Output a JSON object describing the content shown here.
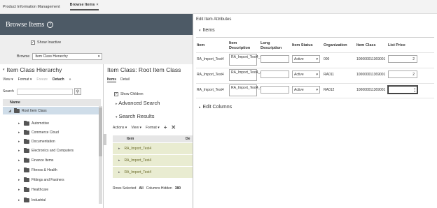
{
  "topbar": {
    "tabs": [
      {
        "label": "Product Information Management"
      },
      {
        "label": "Browse Items",
        "close": "×"
      }
    ]
  },
  "header": {
    "title": "Browse Items",
    "help_icon": "?"
  },
  "filters": {
    "show_inactive_label": "Show Inactive",
    "browse_label": "Browse",
    "browse_value": "Item Class Hierarchy"
  },
  "left_panel": {
    "title": "Item Class Hierarchy",
    "toolbar": {
      "view": "View",
      "format": "Format",
      "freeze": "Freeze",
      "detach": "Detach",
      "more": "»"
    },
    "search_label": "Search",
    "column_header": "Name",
    "tree": [
      {
        "label": "Root Item Class",
        "level": 0
      },
      {
        "label": "Automotive",
        "level": 1
      },
      {
        "label": "Commerce Cloud",
        "level": 1
      },
      {
        "label": "Documentation",
        "level": 1
      },
      {
        "label": "Electronics and Computers",
        "level": 1
      },
      {
        "label": "Finance Items",
        "level": 1
      },
      {
        "label": "Fitness & Health",
        "level": 1
      },
      {
        "label": "Fittings and Fastners",
        "level": 1
      },
      {
        "label": "Healthcare",
        "level": 1
      },
      {
        "label": "Industrial",
        "level": 1
      }
    ]
  },
  "mid_panel": {
    "title": "Item Class: Root Item Class",
    "tabs": [
      "Items",
      "Detail"
    ],
    "show_children": "Show Children",
    "advanced_search": "Advanced Search",
    "search_results": "Search Results",
    "toolbar": {
      "actions": "Actions",
      "view": "View",
      "format": "Format"
    },
    "columns": [
      "Item",
      "De"
    ],
    "rows": [
      {
        "item": "RA_Import_Test4"
      },
      {
        "item": "RA_Import_Test4"
      },
      {
        "item": "RA_Import_Test4"
      }
    ],
    "status": {
      "rows_selected_label": "Rows Selected",
      "rows_selected_value": "All",
      "columns_hidden_label": "Columns Hidden",
      "columns_hidden_value": "380"
    }
  },
  "dialog": {
    "title": "Edit Item Attributes",
    "section": "Items",
    "columns": {
      "item": "Item",
      "item_description": "Item Description",
      "long_description": "Long Description",
      "item_status": "Item Status",
      "organization": "Organization",
      "item_class": "Item Class",
      "list_price": "List Price"
    },
    "rows": [
      {
        "item": "RA_Import_Test4",
        "item_description": "RA_Import_Test4_4",
        "long_description": "",
        "item_status": "Active",
        "organization": "000",
        "item_class": "100000011369001",
        "list_price": "2"
      },
      {
        "item": "RA_Import_Test4",
        "item_description": "RA_Import_Test4_4",
        "long_description": "",
        "item_status": "Active",
        "organization": "RA011",
        "item_class": "100000011369001",
        "list_price": "2"
      },
      {
        "item": "RA_Import_Test4",
        "item_description": "RA_Import_Test4_4",
        "long_description": "",
        "item_status": "Active",
        "organization": "RA012",
        "item_class": "100000011369001",
        "list_price": ""
      }
    ],
    "edit_columns": "Edit Columns"
  }
}
